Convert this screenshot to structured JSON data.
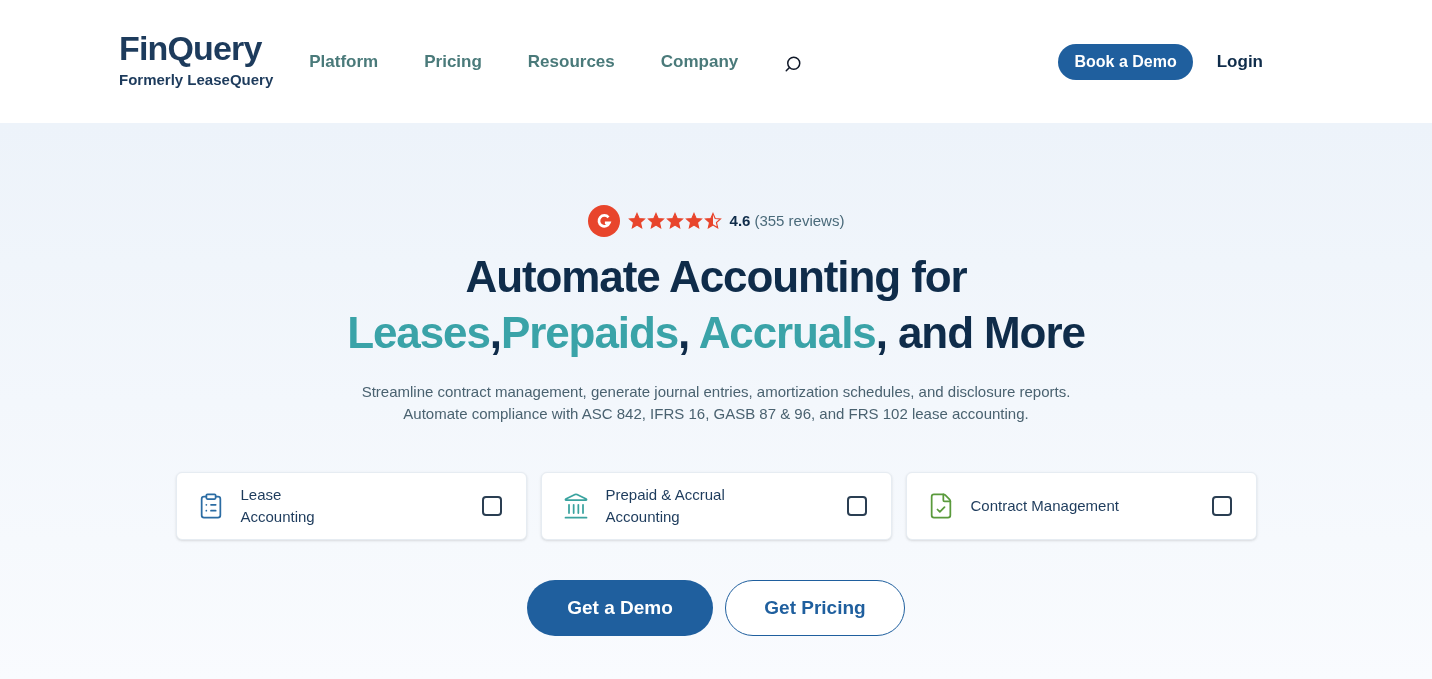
{
  "header": {
    "logo": {
      "name": "FinQuery",
      "tagline": "Formerly LeaseQuery"
    },
    "nav": [
      "Platform",
      "Pricing",
      "Resources",
      "Company"
    ],
    "book_demo": "Book a Demo",
    "login": "Login"
  },
  "hero": {
    "rating": {
      "stars": 4.5,
      "score": "4.6",
      "reviews": "(355 reviews)"
    },
    "headline": [
      {
        "text": "Automate Accounting for ",
        "highlight": false
      },
      {
        "text": "Leases",
        "highlight": true
      },
      {
        "text": ",",
        "highlight": false
      },
      {
        "text": "Prepaids",
        "highlight": true
      },
      {
        "text": ", ",
        "highlight": false
      },
      {
        "text": "Accruals",
        "highlight": true
      },
      {
        "text": ", and More",
        "highlight": false
      }
    ],
    "subtitle": [
      "Streamline contract management, generate journal entries, amortization schedules, and disclosure reports.",
      "Automate compliance with ASC 842, IFRS 16, GASB 87 & 96, and FRS 102 lease accounting."
    ],
    "options": [
      {
        "label": "Lease\nAccounting",
        "checked": false
      },
      {
        "label": "Prepaid & Accrual\nAccounting",
        "checked": false
      },
      {
        "label": "Contract Management",
        "checked": false
      }
    ],
    "primary_button": "Get a Demo",
    "secondary_button": "Get Pricing"
  }
}
